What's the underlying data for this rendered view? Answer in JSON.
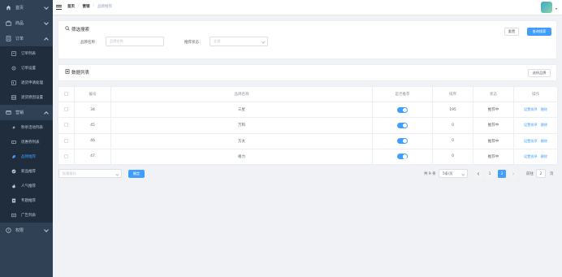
{
  "sidebar": {
    "home": "首页",
    "product": "商品",
    "order": {
      "label": "订单",
      "items": [
        "订单列表",
        "订单设置",
        "退货申请处理",
        "退货原因设置"
      ]
    },
    "marketing": {
      "label": "营销",
      "items": [
        "秒杀活动列表",
        "优惠券列表",
        "品牌推荐",
        "新品推荐",
        "人气推荐",
        "专题推荐",
        "广告列表"
      ]
    },
    "permission": "权限"
  },
  "navbar": {
    "breadcrumb": [
      "首页",
      "营销",
      "品牌推荐"
    ],
    "separator": "/"
  },
  "filter": {
    "title": "筛选搜索",
    "reset_label": "重置",
    "query_label": "查询搜索",
    "brand_name_label": "品牌名称：",
    "brand_name_placeholder": "品牌名称",
    "recommend_status_label": "推荐状态：",
    "recommend_status_placeholder": "全部"
  },
  "list": {
    "title": "数据列表",
    "select_brand_label": "选择品牌"
  },
  "table": {
    "headers": [
      "编号",
      "品牌名称",
      "是否推荐",
      "排序",
      "状态",
      "操作"
    ],
    "rows": [
      {
        "id": "34",
        "name": "三星",
        "sort": "195",
        "status": "推荐中"
      },
      {
        "id": "45",
        "name": "万和",
        "sort": "0",
        "status": "推荐中"
      },
      {
        "id": "46",
        "name": "方太",
        "sort": "0",
        "status": "推荐中"
      },
      {
        "id": "47",
        "name": "格力",
        "sort": "0",
        "status": "推荐中"
      }
    ],
    "action_sort": "设置排序",
    "action_delete": "删除"
  },
  "footer": {
    "batch_placeholder": "批量操作",
    "confirm_label": "确定",
    "total_text": "共 9 条",
    "page_size": "5条/页",
    "pages": [
      "1",
      "2"
    ],
    "active_page": "2",
    "goto_label": "前往",
    "goto_value": "2",
    "page_unit": "页"
  },
  "colors": {
    "sidebar_bg": "#304156",
    "submenu_bg": "#1f2d3d",
    "accent": "#409eff"
  }
}
